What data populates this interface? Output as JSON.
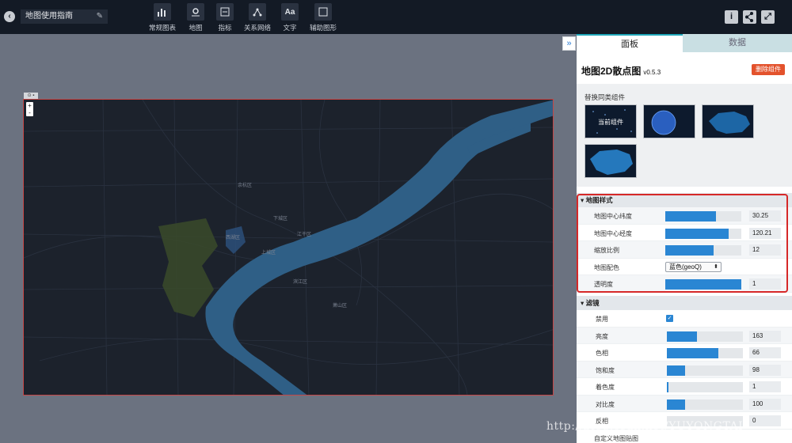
{
  "app": {
    "title": "地图使用指南",
    "back_icon": "back-icon",
    "edit_icon": "edit-icon"
  },
  "toolbar": {
    "items": [
      {
        "label": "常规图表",
        "icon": "chart-icon",
        "glyph": "📊"
      },
      {
        "label": "地图",
        "icon": "map-pin-icon",
        "glyph": "⌖"
      },
      {
        "label": "指标",
        "icon": "indicator-icon",
        "glyph": "≡"
      },
      {
        "label": "关系网络",
        "icon": "network-icon",
        "glyph": "⁂"
      },
      {
        "label": "文字",
        "icon": "text-icon",
        "glyph": "Aa"
      },
      {
        "label": "辅助图形",
        "icon": "shape-icon",
        "glyph": "▢"
      }
    ],
    "right_buttons": [
      {
        "icon": "info-icon",
        "glyph": "i"
      },
      {
        "icon": "share-icon",
        "glyph": "<"
      },
      {
        "icon": "fullscreen-icon",
        "glyph": "⤢"
      }
    ]
  },
  "map": {
    "zoom_in": "+",
    "zoom_out": "-",
    "labels": [
      "下城区",
      "江干区",
      "上城区",
      "西湖区",
      "滨江区",
      "萧山区",
      "余杭区"
    ]
  },
  "panel": {
    "tabs": [
      "面板",
      "数据"
    ],
    "component_name": "地图2D散点图",
    "version": "v0.5.3",
    "delete_label": "删除组件",
    "replace_label": "替换同类组件",
    "current_component": "当前组件",
    "collapse_icon": "double-chevron-right-icon",
    "map_style": {
      "header": "地图样式",
      "rows": [
        {
          "label": "地图中心纬度",
          "value": "30.25",
          "fill": 0.67
        },
        {
          "label": "地图中心经度",
          "value": "120.21",
          "fill": 0.83
        },
        {
          "label": "缩放比例",
          "value": "12",
          "fill": 0.64
        },
        {
          "label": "地图配色",
          "value": "蓝色(geoQ)"
        },
        {
          "label": "透明度",
          "value": "1",
          "fill": 1.0
        }
      ]
    },
    "filter": {
      "header": "滤镜",
      "disable_label": "禁用",
      "disabled": true,
      "rows": [
        {
          "label": "亮度",
          "value": "163",
          "fill": 0.4
        },
        {
          "label": "色相",
          "value": "66",
          "fill": 0.68
        },
        {
          "label": "饱和度",
          "value": "98",
          "fill": 0.24
        },
        {
          "label": "着色度",
          "value": "1",
          "fill": 0.02
        },
        {
          "label": "对比度",
          "value": "100",
          "fill": 0.24
        },
        {
          "label": "反相",
          "value": "0",
          "fill": 0.0
        }
      ]
    },
    "custom_texture_label": "自定义地图贴图"
  },
  "watermark": "http://blog.csdn.net/YUYONGTAI",
  "colors": {
    "accent": "#2a86d3",
    "danger": "#e3522c",
    "highlight": "#d62828",
    "topbar": "#131a25"
  }
}
